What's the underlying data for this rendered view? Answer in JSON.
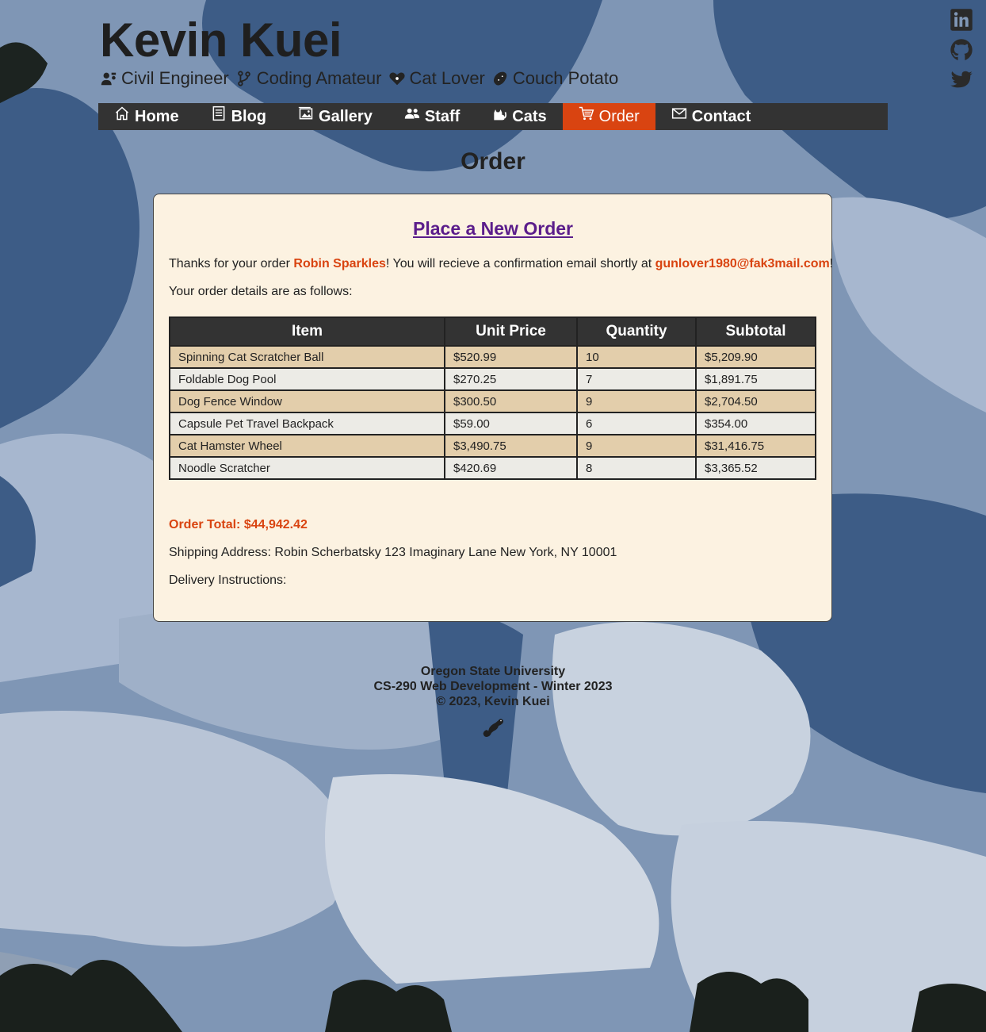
{
  "colors": {
    "accent": "#d94411",
    "nav_bg": "#333333",
    "card_bg": "#fcf2e1",
    "link": "#5b1d8b"
  },
  "header": {
    "site_title": "Kevin Kuei",
    "tags": [
      {
        "icon": "engineer-icon",
        "label": "Civil Engineer"
      },
      {
        "icon": "branch-icon",
        "label": "Coding Amateur"
      },
      {
        "icon": "heart-paw-icon",
        "label": "Cat Lover"
      },
      {
        "icon": "potato-icon",
        "label": "Couch Potato"
      }
    ]
  },
  "social": [
    "linkedin-icon",
    "github-icon",
    "twitter-icon"
  ],
  "nav": {
    "items": [
      {
        "icon": "home-icon",
        "label": "Home"
      },
      {
        "icon": "blog-icon",
        "label": "Blog"
      },
      {
        "icon": "gallery-icon",
        "label": "Gallery"
      },
      {
        "icon": "staff-icon",
        "label": "Staff"
      },
      {
        "icon": "cat-icon",
        "label": "Cats"
      },
      {
        "icon": "cart-icon",
        "label": "Order",
        "active": true
      },
      {
        "icon": "mail-icon",
        "label": "Contact"
      }
    ]
  },
  "main": {
    "heading": "Order",
    "card_title": "Place a New Order",
    "thanks_prefix": "Thanks for your order ",
    "customer_name": "Robin Sparkles",
    "thanks_middle": "! You will recieve a confirmation email shortly at ",
    "email": "gunlover1980@fak3mail.com",
    "thanks_suffix": "!",
    "details_intro": "Your order details are as follows:",
    "table": {
      "headers": [
        "Item",
        "Unit Price",
        "Quantity",
        "Subtotal"
      ],
      "rows": [
        [
          "Spinning Cat Scratcher Ball",
          "$520.99",
          "10",
          "$5,209.90"
        ],
        [
          "Foldable Dog Pool",
          "$270.25",
          "7",
          "$1,891.75"
        ],
        [
          "Dog Fence Window",
          "$300.50",
          "9",
          "$2,704.50"
        ],
        [
          "Capsule Pet Travel Backpack",
          "$59.00",
          "6",
          "$354.00"
        ],
        [
          "Cat Hamster Wheel",
          "$3,490.75",
          "9",
          "$31,416.75"
        ],
        [
          "Noodle Scratcher",
          "$420.69",
          "8",
          "$3,365.52"
        ]
      ]
    },
    "order_total": "Order Total: $44,942.42",
    "shipping": "Shipping Address: Robin Scherbatsky 123 Imaginary Lane New York, NY 10001",
    "delivery": "Delivery Instructions:"
  },
  "footer": {
    "line1": "Oregon State University",
    "line2": "CS-290 Web Development - Winter 2023",
    "line3": "© 2023, Kevin Kuei",
    "logo_icon": "beaver-icon"
  }
}
